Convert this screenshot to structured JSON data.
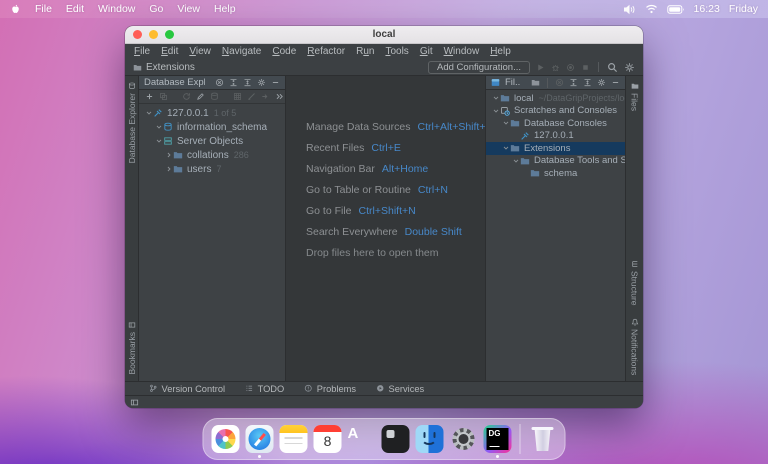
{
  "menubar": {
    "items": [
      "File",
      "Edit",
      "Window",
      "Go",
      "View",
      "Help"
    ],
    "time": "16:23",
    "day": "Friday"
  },
  "window": {
    "title": "local",
    "menu": [
      {
        "label": "File",
        "m": 0
      },
      {
        "label": "Edit",
        "m": 0
      },
      {
        "label": "View",
        "m": 0
      },
      {
        "label": "Navigate",
        "m": 0
      },
      {
        "label": "Code",
        "m": 0
      },
      {
        "label": "Refactor",
        "m": 0
      },
      {
        "label": "Run",
        "m": 1
      },
      {
        "label": "Tools",
        "m": 0
      },
      {
        "label": "Git",
        "m": 0
      },
      {
        "label": "Window",
        "m": 0
      },
      {
        "label": "Help",
        "m": 0
      }
    ],
    "toolbar": {
      "breadcrumb": "Extensions",
      "add_configuration": "Add Configuration..."
    },
    "left_strip": {
      "top": "Database Explorer",
      "bottom": "Bookmarks"
    },
    "right_strip": {
      "top": "Files",
      "middle": "Structure",
      "bottom": "Notifications"
    },
    "database_panel": {
      "title": "Database Explor",
      "tree": [
        {
          "label": "127.0.0.1",
          "badge": "1 of 5",
          "icon": "plug",
          "level": 0,
          "expanded": true
        },
        {
          "label": "information_schema",
          "icon": "schema",
          "level": 1,
          "expanded": true
        },
        {
          "label": "Server Objects",
          "icon": "server",
          "level": 1,
          "expanded": true
        },
        {
          "label": "collations",
          "badge": "286",
          "icon": "folder",
          "level": 2,
          "expanded": false
        },
        {
          "label": "users",
          "badge": "7",
          "icon": "folder",
          "level": 2,
          "expanded": false
        }
      ]
    },
    "editor": {
      "shortcuts": [
        {
          "label": "Manage Data Sources",
          "keys": "Ctrl+Alt+Shift+S"
        },
        {
          "label": "Recent Files",
          "keys": "Ctrl+E"
        },
        {
          "label": "Navigation Bar",
          "keys": "Alt+Home"
        },
        {
          "label": "Go to Table or Routine",
          "keys": "Ctrl+N"
        },
        {
          "label": "Go to File",
          "keys": "Ctrl+Shift+N"
        },
        {
          "label": "Search Everywhere",
          "keys": "Double Shift"
        }
      ],
      "hint": "Drop files here to open them"
    },
    "files_panel": {
      "title": "Fil...",
      "tree": [
        {
          "label": "local",
          "suffix": "~/DataGripProjects/local",
          "icon": "folder",
          "level": 0,
          "expanded": true
        },
        {
          "label": "Scratches and Consoles",
          "icon": "scratches",
          "level": 0,
          "expanded": true
        },
        {
          "label": "Database Consoles",
          "icon": "folder",
          "level": 1,
          "expanded": true
        },
        {
          "label": "127.0.0.1",
          "icon": "plug",
          "level": 2
        },
        {
          "label": "Extensions",
          "icon": "folder",
          "level": 1,
          "expanded": true,
          "selected": true
        },
        {
          "label": "Database Tools and SQL",
          "icon": "folder",
          "level": 2,
          "expanded": true
        },
        {
          "label": "schema",
          "icon": "folder",
          "level": 3
        }
      ]
    },
    "bottom_bar": [
      {
        "label": "Version Control",
        "icon": "branch"
      },
      {
        "label": "TODO",
        "icon": "list"
      },
      {
        "label": "Problems",
        "icon": "alert"
      },
      {
        "label": "Services",
        "icon": "playcircle"
      }
    ]
  },
  "dock": [
    {
      "name": "Photos"
    },
    {
      "name": "Safari",
      "running": true
    },
    {
      "name": "Notes"
    },
    {
      "name": "Calendar",
      "badge": "8"
    },
    {
      "name": "App Store"
    },
    {
      "name": "Screenshot"
    },
    {
      "name": "Finder"
    },
    {
      "name": "System Settings"
    },
    {
      "name": "DataGrip",
      "running": true
    },
    {
      "name": "Trash"
    }
  ],
  "colors": {
    "accent_blue": "#4788c9",
    "selection": "#153a5e",
    "panel_bg": "#3e4245",
    "editor_bg": "#343739",
    "titlebar_bg": "#e9e7ea"
  }
}
